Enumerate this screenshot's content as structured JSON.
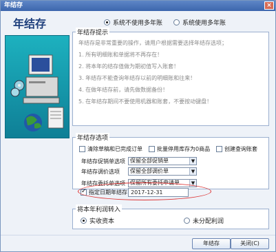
{
  "window": {
    "title": "年结存",
    "close_label": "×"
  },
  "header": {
    "heading": "年结存"
  },
  "mode": {
    "option1": "系统不使用多年账",
    "option2": "系统使用多年账",
    "selected": "option1"
  },
  "tips": {
    "legend": "年结存提示",
    "lines": [
      "年结存是非常重要的操作，请用户根据需要选择年结存选项；",
      "1. 所有明细账和单据将不再存在！",
      "2. 将本年的结存值做为期初值写入账套！",
      "3. 年结存不能查询年结存以前的明细账和往来！",
      "4. 在做年结存前，请先做数据备份！",
      "5. 在年结存期间不要使用机器和账套，不要按动键盘！"
    ]
  },
  "options": {
    "legend": "年结存选项",
    "check1": "清除草稿和已完成订单",
    "check2": "批量停用库存为0商品",
    "check3": "创建查询账套",
    "sel1_label": "年结存促销单选项",
    "sel1_value": "保留全部促销单",
    "sel2_label": "年结存调价选项",
    "sel2_value": "保留全部调价单",
    "sel3_label": "年结存委托单选项",
    "sel3_value": "保留所有委托申请单",
    "date_label": "指定日期年结存",
    "date_value": "2017-12-31"
  },
  "profit": {
    "legend": "将本年利润转入",
    "option1": "实收资本",
    "option2": "未分配利润"
  },
  "buttons": {
    "ok": "年结存",
    "close": "关闭(C)"
  }
}
